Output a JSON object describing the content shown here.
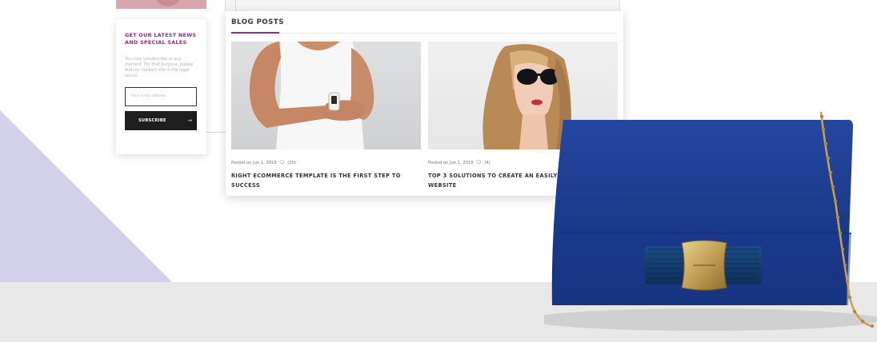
{
  "newsletter": {
    "title": "GET OUR LATEST NEWS AND SPECIAL SALES",
    "text": "You may unsubscribe at any moment. For that purpose, please find our contact info in the legal notice.",
    "email_placeholder": "Your email address",
    "subscribe_label": "SUBSCRIBE",
    "arrow_icon": "arrow-right-icon"
  },
  "blog": {
    "heading": "BLOG POSTS",
    "accent_color": "#8e2e8c",
    "posts": [
      {
        "image": "man-with-smartwatch-photo",
        "date": "Posted on Jun 1, 2018",
        "comment_icon": "comment-icon",
        "comments": "(20)",
        "title": "RIGHT ECOMMERCE TEMPLATE IS THE FIRST STEP TO SUCCESS"
      },
      {
        "image": "woman-in-sunglasses-photo",
        "date": "Posted on Jun 1, 2018",
        "comment_icon": "comment-icon",
        "comments": "(4)",
        "title": "TOP 3 SOLUTIONS TO CREATE AN EASILY NAVIGABLE WEBSITE"
      }
    ]
  },
  "colors": {
    "triangle": "#d3d0ec",
    "floor": "#e8e8e8",
    "bag": "#1d3f9a",
    "button": "#1e1e1e"
  }
}
